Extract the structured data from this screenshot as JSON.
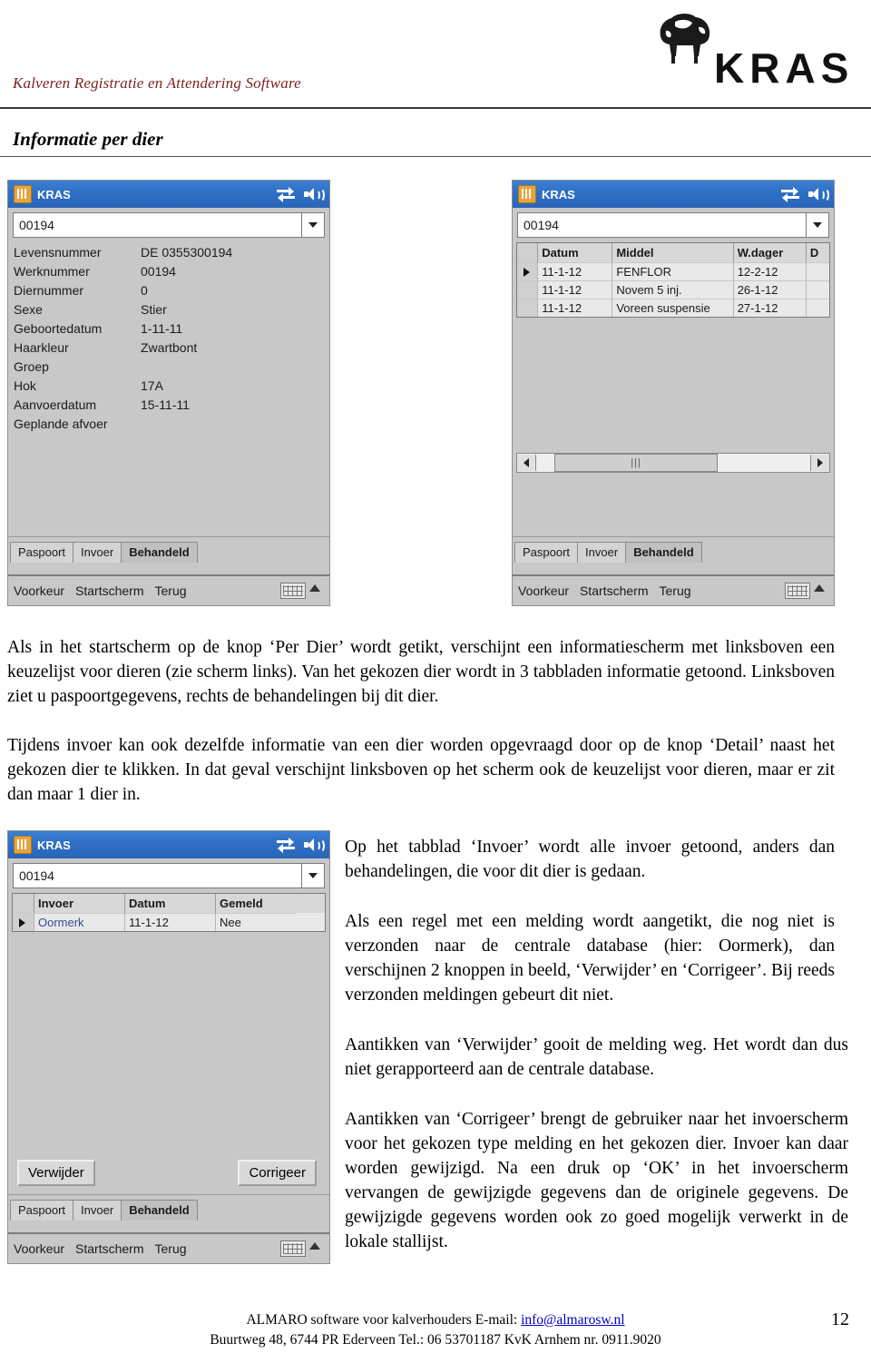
{
  "header": {
    "subtitle": "Kalveren Registratie en Attendering Software",
    "logo_text": "KRAS"
  },
  "section_title": "Informatie per dier",
  "pda_left": {
    "title": "KRAS",
    "combo_value": "00194",
    "fields": [
      {
        "label": "Levensnummer",
        "value": "DE 0355300194"
      },
      {
        "label": "Werknummer",
        "value": "00194"
      },
      {
        "label": "Diernummer",
        "value": "0"
      },
      {
        "label": "Sexe",
        "value": "Stier"
      },
      {
        "label": "Geboortedatum",
        "value": "1-11-11"
      },
      {
        "label": "Haarkleur",
        "value": "Zwartbont"
      },
      {
        "label": "Groep",
        "value": ""
      },
      {
        "label": "Hok",
        "value": "17A"
      },
      {
        "label": "Aanvoerdatum",
        "value": "15-11-11"
      },
      {
        "label": "Geplande afvoer",
        "value": ""
      }
    ],
    "tabs": [
      {
        "label": "Paspoort",
        "active": false
      },
      {
        "label": "Invoer",
        "active": false
      },
      {
        "label": "Behandeld",
        "active": true
      }
    ],
    "bottom_buttons": [
      "Voorkeur",
      "Startscherm",
      "Terug"
    ]
  },
  "pda_right": {
    "title": "KRAS",
    "combo_value": "00194",
    "grid": {
      "columns": [
        "Datum",
        "Middel",
        "W.dager",
        "D"
      ],
      "rows": [
        {
          "selected": true,
          "cells": [
            "11-1-12",
            "FENFLOR",
            "12-2-12",
            ""
          ]
        },
        {
          "selected": false,
          "cells": [
            "11-1-12",
            "Novem 5 inj.",
            "26-1-12",
            ""
          ]
        },
        {
          "selected": false,
          "cells": [
            "11-1-12",
            "Voreen suspensie",
            "27-1-12",
            ""
          ]
        }
      ]
    },
    "scrollbar_grip": "|||",
    "tabs": [
      {
        "label": "Paspoort",
        "active": false
      },
      {
        "label": "Invoer",
        "active": false
      },
      {
        "label": "Behandeld",
        "active": true
      }
    ],
    "bottom_buttons": [
      "Voorkeur",
      "Startscherm",
      "Terug"
    ]
  },
  "pda_bottom": {
    "title": "KRAS",
    "combo_value": "00194",
    "grid": {
      "columns": [
        "Invoer",
        "Datum",
        "Gemeld"
      ],
      "rows": [
        {
          "selected": true,
          "cells": [
            "Oormerk",
            "11-1-12",
            "Nee"
          ]
        }
      ]
    },
    "buttons": [
      {
        "label": "Verwijder"
      },
      {
        "label": "Corrigeer"
      }
    ],
    "tabs": [
      {
        "label": "Paspoort",
        "active": false
      },
      {
        "label": "Invoer",
        "active": false
      },
      {
        "label": "Behandeld",
        "active": true
      }
    ],
    "bottom_buttons": [
      "Voorkeur",
      "Startscherm",
      "Terug"
    ]
  },
  "paragraphs": {
    "p1": "Als in het startscherm op de knop ‘Per Dier’ wordt getikt, verschijnt een informatiescherm met linksboven een keuzelijst voor dieren (zie scherm links). Van het gekozen dier wordt in 3 tabbladen informatie getoond. Linksboven ziet u paspoortgegevens, rechts de behandelingen bij dit dier.",
    "p2": "Tijdens invoer kan ook dezelfde informatie van een dier worden opgevraagd door op de knop ‘Detail’ naast het gekozen dier te klikken. In dat geval verschijnt linksboven op het scherm ook de keuzelijst voor dieren, maar er zit dan maar 1 dier in.",
    "p3": "Op het tabblad ‘Invoer’ wordt alle invoer getoond, anders dan behandelingen, die voor dit dier is gedaan.",
    "p4": "Als een regel met een melding wordt aangetikt, die nog niet is verzonden naar de centrale database (hier: Oormerk), dan verschijnen 2 knoppen in beeld, ‘Verwijder’ en ‘Corrigeer’. Bij reeds verzonden meldingen gebeurt dit niet.",
    "p5": "Aantikken van ‘Verwijder’ gooit de melding weg. Het wordt dan dus niet gerapporteerd aan de centrale database.",
    "p6": "Aantikken van ‘Corrigeer’ brengt de gebruiker naar het invoerscherm voor het gekozen type melding en het gekozen dier. Invoer kan daar worden gewijzigd. Na een druk op ‘OK’ in het invoerscherm vervangen de gewijzigde gegevens dan de originele gegevens. De gewijzigde gegevens worden ook zo goed mogelijk verwerkt in de lokale stallijst."
  },
  "footer": {
    "line1_pre": "ALMARO software voor kalverhouders  E-mail: ",
    "line1_link": "info@almarosw.nl",
    "line2": "Buurtweg 48, 6744 PR  Ederveen  Tel.: 06 53701187  KvK Arnhem nr. 0911.9020",
    "page_number": "12"
  }
}
